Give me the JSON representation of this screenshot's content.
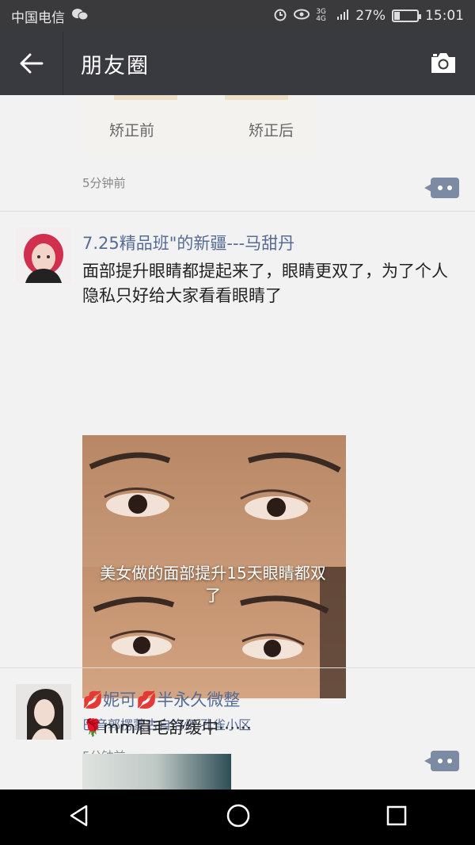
{
  "status_bar": {
    "carrier": "中国电信",
    "network": "3G 4G",
    "battery": "27%",
    "battery_level": 0.27,
    "time": "15:01"
  },
  "nav": {
    "title": "朋友圈",
    "back_icon": "arrow-left-icon",
    "camera_icon": "camera-icon"
  },
  "posts": [
    {
      "image_caption_left": "矫正前",
      "image_caption_right": "矫正后",
      "time": "5分钟前"
    },
    {
      "author": "7.25精品班\"的新疆---马甜丹",
      "text": "面部提升眼睛都提起来了，眼睛更双了，为了个人隐私只好给大家看看眼睛了",
      "image_overlay": "美女做的面部提升15天眼睛都双了",
      "location": "巴音郭楞蒙古自治州·孔雀小区",
      "time": "5分钟前"
    },
    {
      "author": "💋妮可💋半永久微整",
      "text": "🌹mm眉毛舒缓中⋯⋯"
    }
  ],
  "sysnav": {
    "back": "triangle-back-icon",
    "home": "circle-home-icon",
    "recents": "square-recents-icon"
  }
}
